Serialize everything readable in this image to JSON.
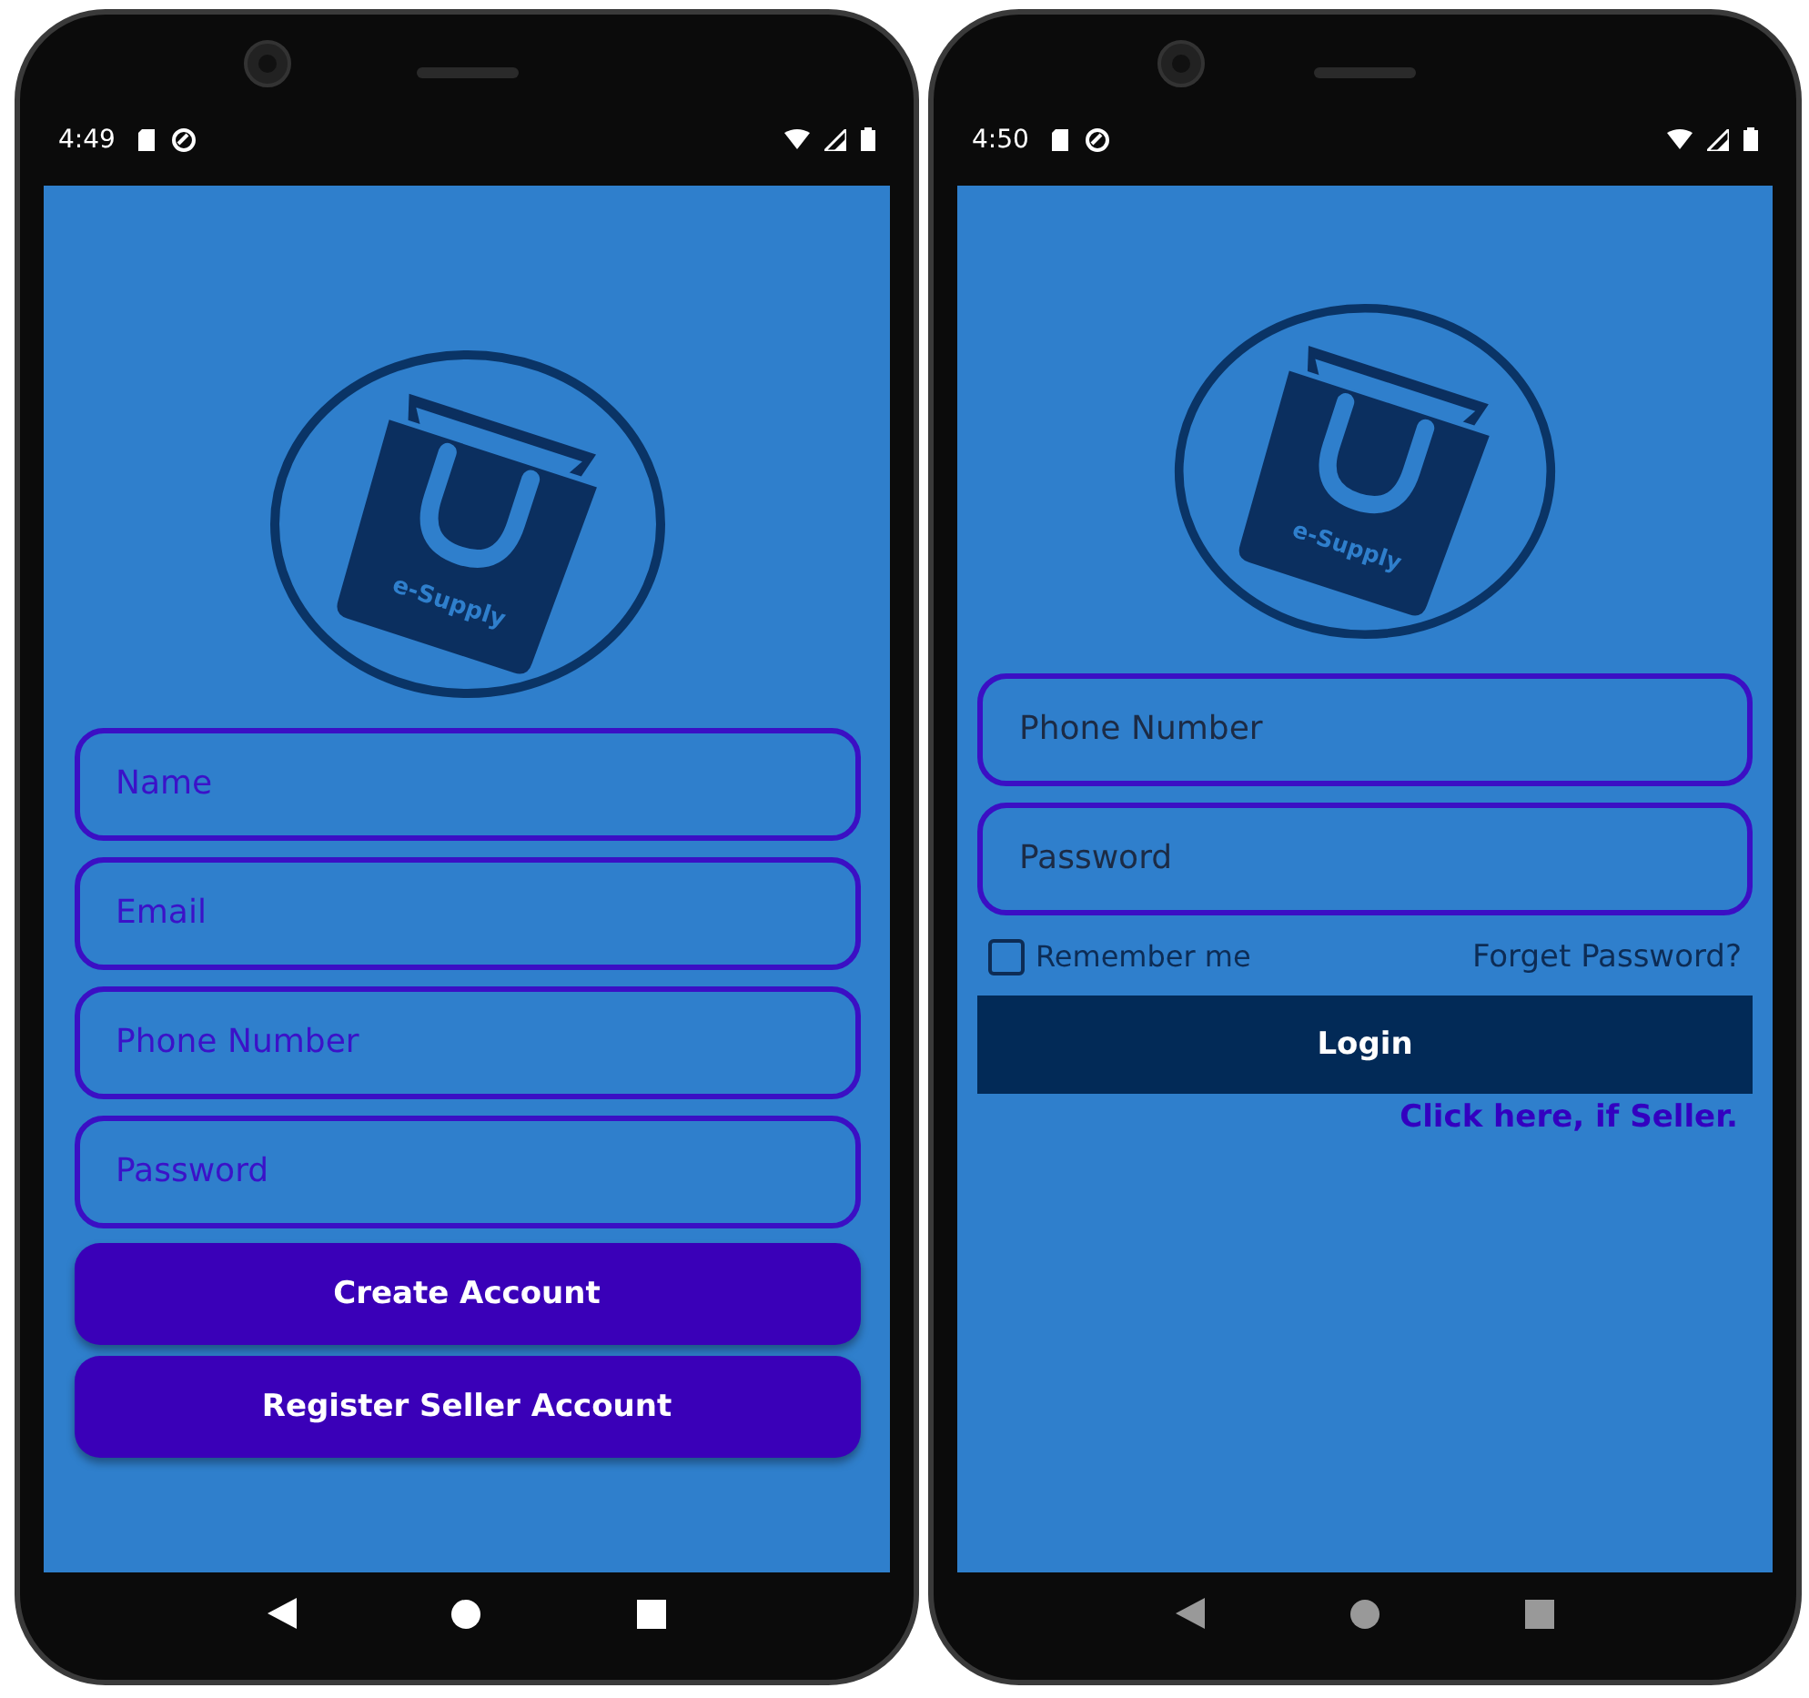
{
  "register_phone": {
    "status_time": "4:49",
    "logo_text": "e-Supply",
    "fields": [
      {
        "placeholder": "Name"
      },
      {
        "placeholder": "Email"
      },
      {
        "placeholder": "Phone Number"
      },
      {
        "placeholder": "Password"
      }
    ],
    "buttons": [
      "Create Account",
      "Register Seller Account"
    ]
  },
  "login_phone": {
    "status_time": "4:50",
    "logo_text": "e-Supply",
    "fields": [
      {
        "placeholder": "Phone Number"
      },
      {
        "placeholder": "Password"
      }
    ],
    "remember": {
      "label": "Remember me",
      "checked": false
    },
    "forgot_link": "Forget Password?",
    "login_button": "Login",
    "seller_link": "Click here, if Seller."
  }
}
